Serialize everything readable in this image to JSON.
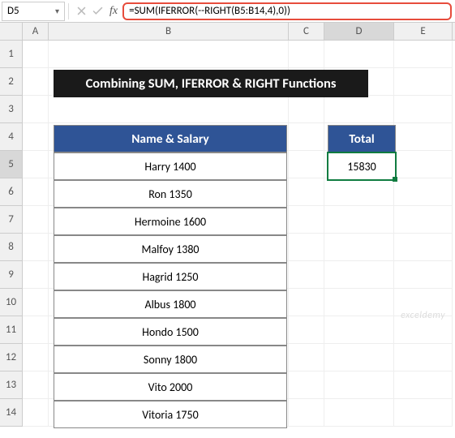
{
  "nameBox": "D5",
  "formula": "=SUM(IFERROR(--RIGHT(B5:B14,4),0))",
  "columns": [
    "A",
    "B",
    "C",
    "D",
    "E"
  ],
  "rowNumbers": [
    "1",
    "2",
    "3",
    "4",
    "5",
    "6",
    "7",
    "8",
    "9",
    "10",
    "11",
    "12",
    "13",
    "14"
  ],
  "title": "Combining SUM, IFERROR & RIGHT Functions",
  "headers": {
    "B": "Name & Salary",
    "D": "Total"
  },
  "dataB": [
    "Harry 1400",
    "Ron 1350",
    "Hermoine 1600",
    "Malfoy 1380",
    "Hagrid 1250",
    "Albus 1800",
    "Hondo 1500",
    "Sonny 1800",
    "Vito 2000",
    "Vitoria 1750"
  ],
  "total": "15830",
  "watermark": "exceldemy"
}
